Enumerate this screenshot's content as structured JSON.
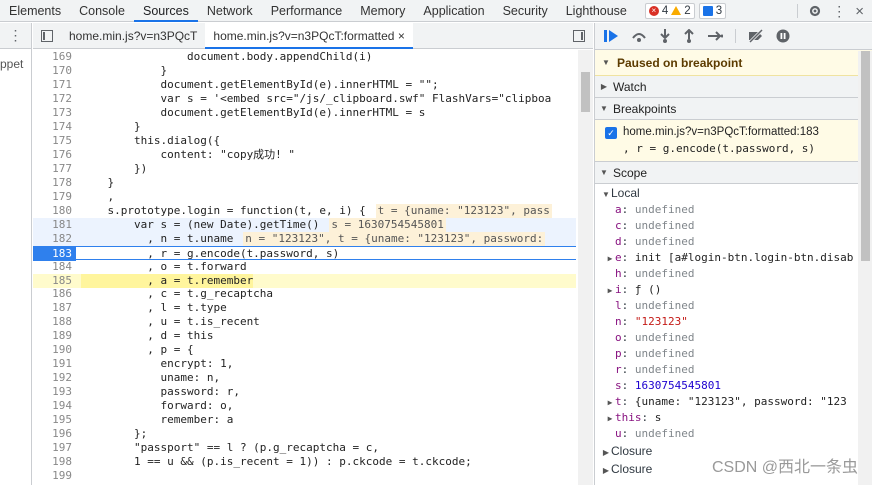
{
  "devtools": {
    "tabs": [
      "Elements",
      "Console",
      "Sources",
      "Network",
      "Performance",
      "Memory",
      "Application",
      "Security",
      "Lighthouse"
    ],
    "active_tab": "Sources",
    "errors": "4",
    "warnings": "2",
    "messages": "3"
  },
  "leftnav": {
    "snippet": "ppet"
  },
  "editor": {
    "file_tabs": [
      {
        "label": "home.min.js?v=n3PQcT"
      },
      {
        "label": "home.min.js?v=n3PQcT:formatted",
        "close": "×"
      }
    ],
    "lines": [
      {
        "n": "169",
        "code": "                document.body.appendChild(i)"
      },
      {
        "n": "170",
        "code": "            }"
      },
      {
        "n": "171",
        "code": "            document.getElementById(e).innerHTML = \"\";"
      },
      {
        "n": "172",
        "code": "            var s = '<embed src=\"/js/_clipboard.swf\" FlashVars=\"clipboa"
      },
      {
        "n": "173",
        "code": "            document.getElementById(e).innerHTML = s"
      },
      {
        "n": "174",
        "code": "        }"
      },
      {
        "n": "175",
        "code": "        this.dialog({"
      },
      {
        "n": "176",
        "code": "            content: \"copy成功! \""
      },
      {
        "n": "177",
        "code": "        })"
      },
      {
        "n": "178",
        "code": "    }"
      },
      {
        "n": "179",
        "code": "    ,"
      },
      {
        "n": "180",
        "code": "    s.prototype.login = function(t, e, i) {",
        "inline": "t = {uname: \"123123\", pass"
      },
      {
        "n": "181",
        "code": "        var s = (new Date).getTime()",
        "inline": "s = 1630754545801"
      },
      {
        "n": "182",
        "code": "          , n = t.uname",
        "inline": "n = \"123123\", t = {uname: \"123123\", password:"
      },
      {
        "n": "183",
        "code": "          , r = g.encode(t.password, s)"
      },
      {
        "n": "184",
        "code": "          , o = t.forward"
      },
      {
        "n": "185",
        "code": "          , a = t.remember"
      },
      {
        "n": "186",
        "code": "          , c = t.g_recaptcha"
      },
      {
        "n": "187",
        "code": "          , l = t.type"
      },
      {
        "n": "188",
        "code": "          , u = t.is_recent"
      },
      {
        "n": "189",
        "code": "          , d = this"
      },
      {
        "n": "190",
        "code": "          , p = {"
      },
      {
        "n": "191",
        "code": "            encrypt: 1,"
      },
      {
        "n": "192",
        "code": "            uname: n,"
      },
      {
        "n": "193",
        "code": "            password: r,"
      },
      {
        "n": "194",
        "code": "            forward: o,"
      },
      {
        "n": "195",
        "code": "            remember: a"
      },
      {
        "n": "196",
        "code": "        };"
      },
      {
        "n": "197",
        "code": "        \"passport\" == l ? (p.g_recaptcha = c,"
      },
      {
        "n": "198",
        "code": "        1 == u && (p.is_recent = 1)) : p.ckcode = t.ckcode;"
      },
      {
        "n": "199",
        "code": ""
      }
    ]
  },
  "debugger": {
    "paused": "Paused on breakpoint",
    "sections": {
      "watch": "Watch",
      "breakpoints": "Breakpoints",
      "scope": "Scope",
      "local": "Local"
    },
    "breakpoint": {
      "name": "home.min.js?v=n3PQcT:formatted:183",
      "code": ", r = g.encode(t.password, s)"
    },
    "scope": [
      {
        "k": "a",
        "v": "undefined",
        "t": "und"
      },
      {
        "k": "c",
        "v": "undefined",
        "t": "und"
      },
      {
        "k": "d",
        "v": "undefined",
        "t": "und"
      },
      {
        "k": "e",
        "v": "init [a#login-btn.login-btn.disab",
        "t": "obj",
        "exp": true
      },
      {
        "k": "h",
        "v": "undefined",
        "t": "und"
      },
      {
        "k": "i",
        "v": "ƒ ()",
        "t": "obj",
        "exp": true
      },
      {
        "k": "l",
        "v": "undefined",
        "t": "und"
      },
      {
        "k": "n",
        "v": "\"123123\"",
        "t": "str"
      },
      {
        "k": "o",
        "v": "undefined",
        "t": "und"
      },
      {
        "k": "p",
        "v": "undefined",
        "t": "und"
      },
      {
        "k": "r",
        "v": "undefined",
        "t": "und"
      },
      {
        "k": "s",
        "v": "1630754545801",
        "t": "num"
      },
      {
        "k": "t",
        "v": "{uname: \"123123\", password: \"123",
        "t": "obj",
        "exp": true
      },
      {
        "k": "this",
        "v": "s",
        "t": "obj",
        "exp": true
      },
      {
        "k": "u",
        "v": "undefined",
        "t": "und"
      }
    ],
    "closures": [
      "Closure",
      "Closure"
    ]
  },
  "watermark": "CSDN @西北一条虫"
}
